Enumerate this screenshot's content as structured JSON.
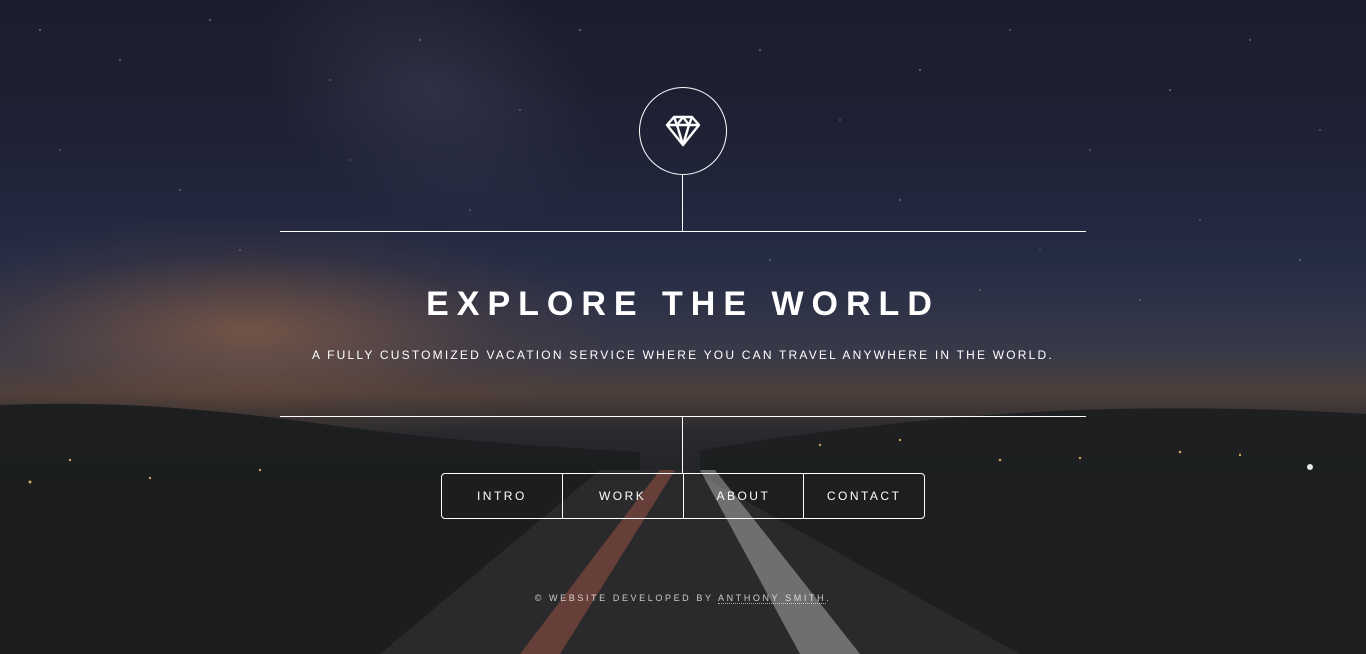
{
  "header": {
    "logo_icon": "diamond-icon",
    "title": "EXPLORE THE WORLD",
    "subtitle": "A FULLY CUSTOMIZED VACATION SERVICE WHERE YOU CAN TRAVEL ANYWHERE IN THE WORLD."
  },
  "nav": {
    "items": [
      {
        "label": "INTRO"
      },
      {
        "label": "WORK"
      },
      {
        "label": "ABOUT"
      },
      {
        "label": "CONTACT"
      }
    ]
  },
  "footer": {
    "prefix": "© WEBSITE DEVELOPED BY",
    "author_link": "ANTHONY SMITH",
    "suffix": "."
  },
  "colors": {
    "foreground": "#ffffff",
    "sky": "#1f2235",
    "horizon_glow": "#be7846"
  }
}
